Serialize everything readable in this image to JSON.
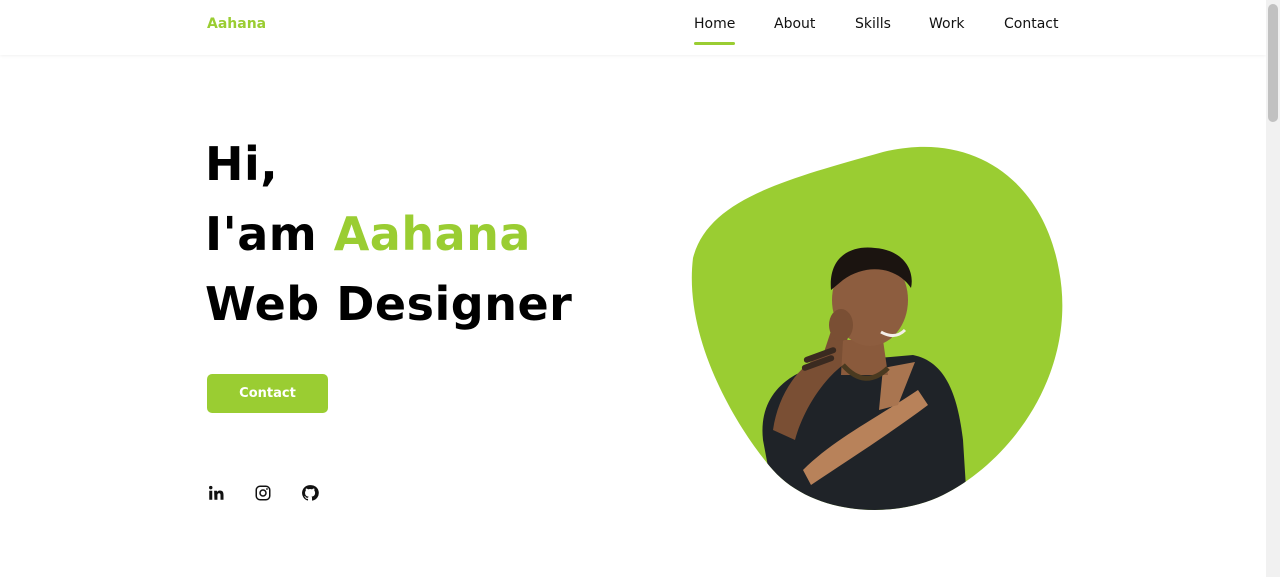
{
  "header": {
    "logo": "Aahana",
    "nav": [
      {
        "label": "Home",
        "active": true
      },
      {
        "label": "About",
        "active": false
      },
      {
        "label": "Skills",
        "active": false
      },
      {
        "label": "Work",
        "active": false
      },
      {
        "label": "Contact",
        "active": false
      }
    ]
  },
  "hero": {
    "greeting": "Hi,",
    "intro_prefix": "I'am",
    "name": "Aahana",
    "role": "Web Designer",
    "button_label": "Contact",
    "socials": [
      {
        "icon": "linkedin-icon"
      },
      {
        "icon": "instagram-icon"
      },
      {
        "icon": "github-icon"
      }
    ],
    "image": {
      "description_icon": "profile-photo"
    }
  },
  "colors": {
    "accent": "#9acd32",
    "text": "#000000",
    "background": "#ffffff"
  }
}
